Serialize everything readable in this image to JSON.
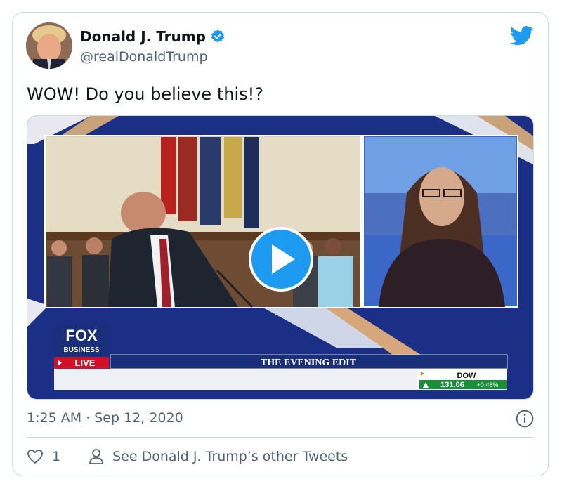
{
  "tweet": {
    "author_name": "Donald J. Trump",
    "author_handle": "@realDonaldTrump",
    "text": "WOW! Do you believe this!?",
    "timestamp": "1:25 AM · Sep 12, 2020",
    "like_count": "1",
    "other_tweets_link": "See Donald J. Trump’s other Tweets"
  },
  "video": {
    "network_logo": "FOX",
    "network_sub": "BUSINESS",
    "live_label": "LIVE",
    "show_title": "THE EVENING EDIT",
    "ticker_name": "DOW",
    "ticker_value": "131.06",
    "ticker_change": "+0.48%"
  },
  "colors": {
    "accent": "#1d9bf0",
    "fox_blue": "#1a2f7a",
    "live_red": "#d3102a",
    "ticker_green": "#1a8f3a"
  },
  "icons": [
    "verified-badge-icon",
    "twitter-bird-icon",
    "play-icon",
    "info-icon",
    "heart-icon",
    "person-icon"
  ]
}
